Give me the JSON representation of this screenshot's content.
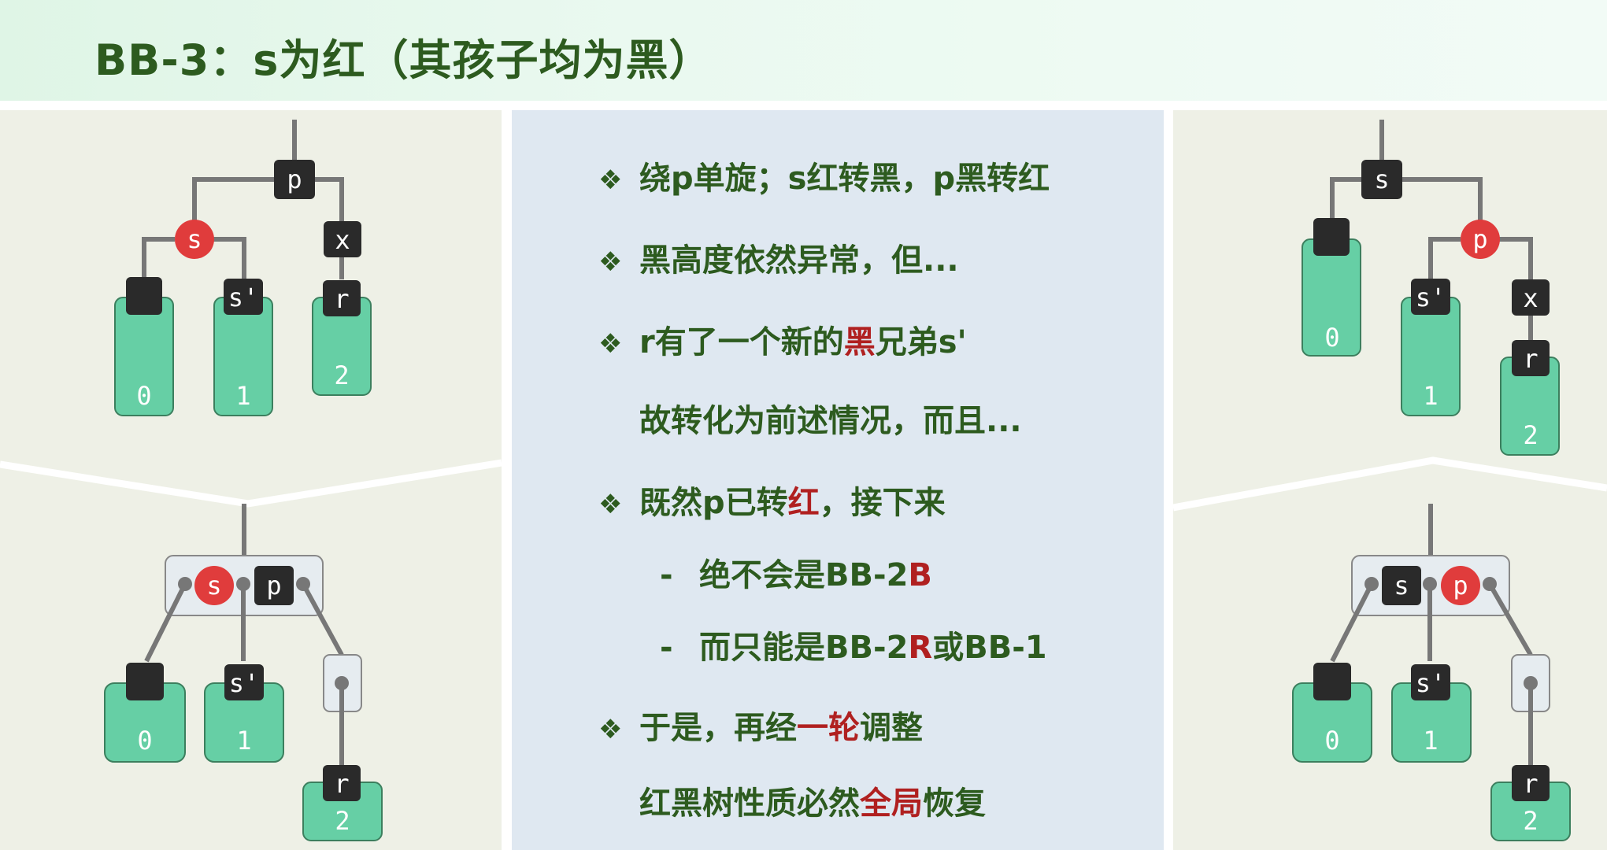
{
  "title": "BB-3：s为红（其孩子均为黑）",
  "bullets": {
    "b1": "绕p单旋；s红转黑，p黑转红",
    "b2": "黑高度依然异常，但...",
    "b3_pre": "r有了一个新的",
    "b3_red": "黑",
    "b3_post": "兄弟s'",
    "b3b": "故转化为前述情况，而且...",
    "b4_pre": "既然p已转",
    "b4_red": "红",
    "b4_post": "，接下来",
    "s1_dash": "-",
    "s1_pre": "绝不会是BB-2",
    "s1_red": "B",
    "s2_dash": "-",
    "s2_pre": "而只能是BB-2",
    "s2_red": "R",
    "s2_post": "或BB-1",
    "b5_pre": "于是，再经",
    "b5_red": "一轮",
    "b5_post": "调整",
    "b5b_pre": "红黑树性质必然",
    "b5b_red": "全局",
    "b5b_post": "恢复",
    "marker": "❖"
  },
  "labels": {
    "p": "p",
    "s": "s",
    "x": "x",
    "r": "r",
    "sp": "s'",
    "z0": "0",
    "z1": "1",
    "z2": "2"
  },
  "colors": {
    "title": "#2d5b1f",
    "red_node": "#e03c3c",
    "black_node": "#2a2a2a",
    "leaf": "#66cfa5",
    "edge": "#777777",
    "accent_red": "#b02020"
  }
}
